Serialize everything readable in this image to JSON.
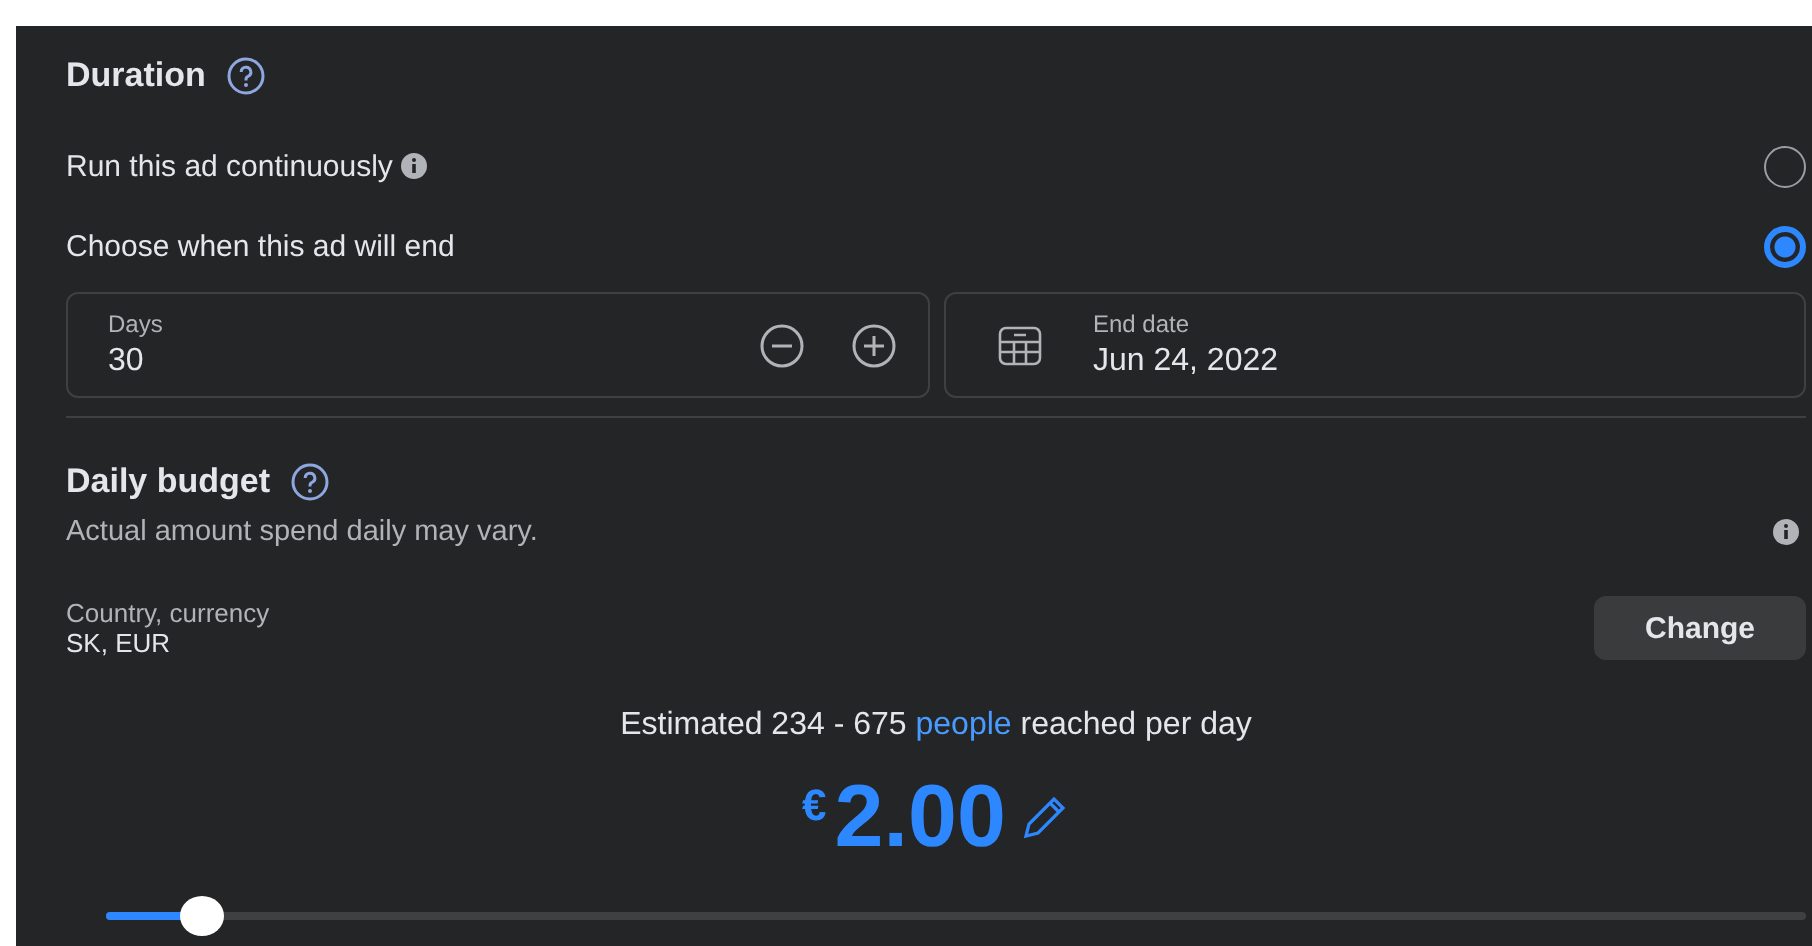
{
  "duration": {
    "title": "Duration",
    "options": [
      {
        "label": "Run this ad continuously",
        "has_info": true,
        "selected": false
      },
      {
        "label": "Choose when this ad will end",
        "has_info": false,
        "selected": true
      }
    ],
    "fields": [
      {
        "kind": "stepper",
        "label": "Days",
        "value": "30"
      },
      {
        "kind": "date",
        "label": "End date",
        "value": "Jun 24, 2022"
      }
    ]
  },
  "budget": {
    "title": "Daily budget",
    "note": "Actual amount spend daily may vary.",
    "country_label": "Country, currency",
    "country_value": "SK, EUR",
    "change_button": "Change",
    "estimate": {
      "before": "Estimated 234 - 675",
      "link": "people",
      "after": "reached per day"
    },
    "currency": "€",
    "amount": "2.00",
    "slider": {
      "level": 0.056
    }
  }
}
